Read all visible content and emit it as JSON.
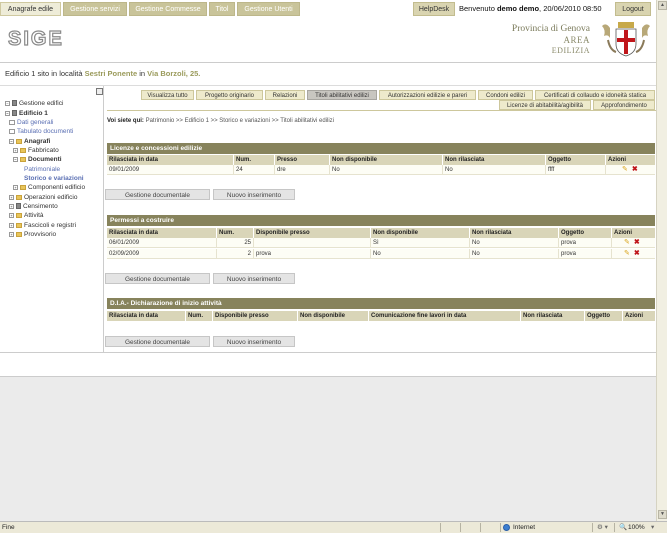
{
  "nav": {
    "tabs": [
      "Anagrafe edile",
      "Gestione servizi",
      "Gestione Commesse",
      "Titol",
      "Gestione Utenti"
    ],
    "helpdesk": "HelpDesk",
    "welcome_prefix": "Benvenuto ",
    "user": "demo demo",
    "datetime": ", 20/06/2010 08:50",
    "logout": "Logout"
  },
  "header": {
    "logo": "SIGE",
    "province_line1": "Provincia di Genova",
    "province_line2": "AREA",
    "province_line3": "EDILIZIA"
  },
  "location": {
    "prefix": "Edificio 1 sito in località ",
    "locality": "Sestri Ponente",
    "in_word": " in ",
    "street": "Via Borzoli, 25."
  },
  "sidebar": {
    "items": [
      "Gestione edifici",
      "Edificio 1",
      "Dati generali",
      "Tabulato documenti",
      "Anagrafi",
      "Fabbricato",
      "Documenti",
      "Patrimoniale",
      "Storico e variazioni",
      "Componenti edificio",
      "Operazioni edificio",
      "Censimento",
      "Attività",
      "Fascicoli e registri",
      "Provvisorio"
    ]
  },
  "subtabs": {
    "row1": [
      "Visualizza tutto",
      "Progetto originario",
      "Relazioni",
      "Titoli abilitativi edilizi",
      "Autorizzazioni edilizie e pareri",
      "Condoni edilizi",
      "Certificati di collaudo e idoneità statica"
    ],
    "row2": [
      "Licenze di abitabilità/agibilità",
      "Approfondimento"
    ]
  },
  "breadcrumb": {
    "label": "Voi siete qui:",
    "path": " Patrimonio >> Edificio 1 >> Storico e variazioni >> Titoli abilitativi edilizi"
  },
  "licenze": {
    "title": "Licenze e concessioni edilizie",
    "columns": [
      "Rilasciata in data",
      "Num.",
      "Presso",
      "Non disponibile",
      "Non rilasciata",
      "Oggetto",
      "Azioni"
    ],
    "rows": [
      [
        "09/01/2009",
        "24",
        "dre",
        "No",
        "No",
        "ffff"
      ]
    ]
  },
  "permessi": {
    "title": "Permessi a costruire",
    "columns": [
      "Rilasciata in data",
      "Num.",
      "Disponibile presso",
      "Non disponibile",
      "Non rilasciata",
      "Oggetto",
      "Azioni"
    ],
    "rows": [
      [
        "06/01/2009",
        "25",
        "",
        "Sì",
        "No",
        "prova"
      ],
      [
        "02/09/2009",
        "2",
        "prova",
        "No",
        "No",
        "prova"
      ]
    ]
  },
  "dia": {
    "title": "D.I.A.- Dichiarazione di inizio attività",
    "columns": [
      "Rilasciata in data",
      "Num.",
      "Disponibile presso",
      "Non disponibile",
      "Comunicazione fine lavori in data",
      "Non rilasciata",
      "Oggetto",
      "Azioni"
    ]
  },
  "buttons": {
    "gestione": "Gestione documentale",
    "nuovo": "Nuovo inserimento"
  },
  "statusbar": {
    "left": "Fine",
    "zone": "Internet",
    "zoom": "100%"
  },
  "colors": {
    "panel_title_bg": "#87835c",
    "panel_header_bg": "#d9d5b8",
    "nav_tab_bg": "#c9c49a",
    "accent_text": "#9b9b5c",
    "delete_red": "#c0161b"
  }
}
